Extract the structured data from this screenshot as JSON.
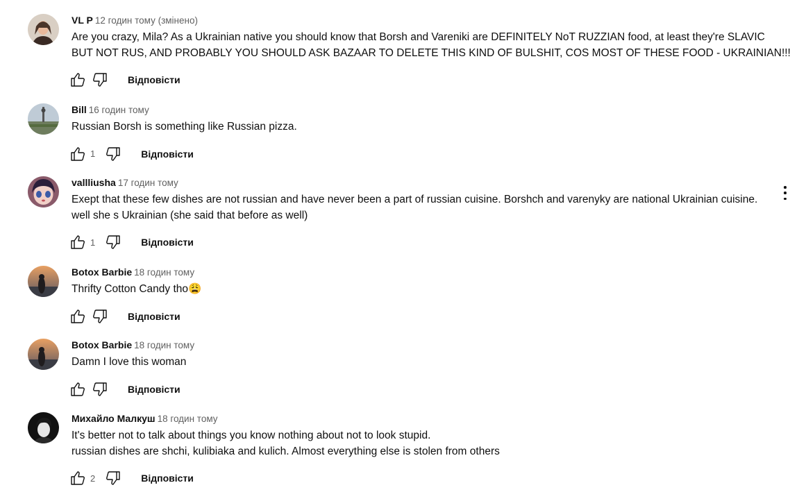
{
  "comments": [
    {
      "author": "VL P",
      "time": "12 годин тому (змінено)",
      "lines": [
        "Are you crazy, Mila? As a Ukrainian native you should know that Borsh and Vareniki are DEFINITELY NoT RUZZIAN food, at least they're SLAVIC",
        "BUT NOT RUS, AND PROBABLY YOU SHOULD ASK BAZAAR TO DELETE THIS KIND OF BULSHIT, COS MOST OF THESE FOOD - UKRAINIAN!!!!!!!"
      ],
      "likes": "",
      "reply": "Відповісти"
    },
    {
      "author": "Bill",
      "time": "16 годин тому",
      "lines": [
        "Russian Borsh is something like Russian pizza."
      ],
      "likes": "1",
      "reply": "Відповісти"
    },
    {
      "author": "vallliusha",
      "time": "17 годин тому",
      "lines": [
        "Exept that these few dishes are not russian and have never been a part of russian cuisine. Borshch and varenyky are national Ukrainian cuisine.",
        "well she s Ukrainian (she said that before as well)"
      ],
      "likes": "1",
      "reply": "Відповісти"
    },
    {
      "author": "Botox Barbie",
      "time": "18 годин тому",
      "lines": [
        "Thrifty Cotton Candy tho😩"
      ],
      "likes": "",
      "reply": "Відповісти"
    },
    {
      "author": "Botox Barbie",
      "time": "18 годин тому",
      "lines": [
        "Damn I love this woman"
      ],
      "likes": "",
      "reply": "Відповісти"
    },
    {
      "author": "Михайло Малкуш",
      "time": "18 годин тому",
      "lines": [
        "It's better not to talk about things you know nothing about not to look stupid.",
        "russian dishes are shchi, kulibiaka and kulich. Almost everything else is stolen from others"
      ],
      "likes": "2",
      "reply": "Відповісти"
    }
  ],
  "icons": {
    "like": "thumb-up-icon",
    "dislike": "thumb-down-icon",
    "more": "vertical-dots-icon"
  }
}
